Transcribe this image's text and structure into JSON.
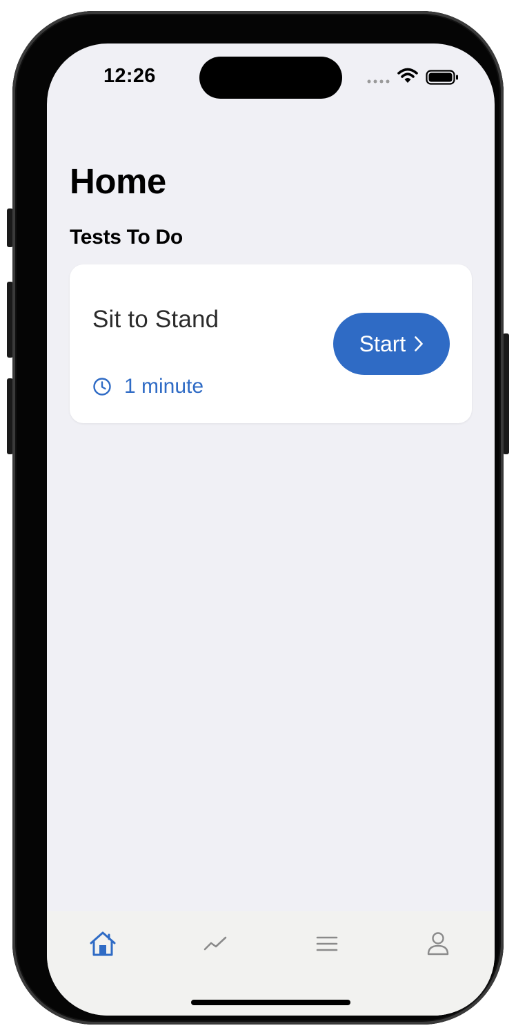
{
  "status_bar": {
    "time": "12:26"
  },
  "header": {
    "title": "Home"
  },
  "tests_section": {
    "title": "Tests To Do",
    "tests": [
      {
        "name": "Sit to Stand",
        "duration": "1 minute",
        "action_label": "Start"
      }
    ]
  },
  "tab_bar": {
    "tabs": [
      {
        "icon": "house-icon",
        "selected": true
      },
      {
        "icon": "trend-line-icon",
        "selected": false
      },
      {
        "icon": "menu-lines-icon",
        "selected": false
      },
      {
        "icon": "person-icon",
        "selected": false
      }
    ]
  },
  "colors": {
    "accent": "#2f6bc5",
    "background": "#f0f0f5",
    "card": "#ffffff",
    "tab_inactive": "#8a8a8a"
  }
}
